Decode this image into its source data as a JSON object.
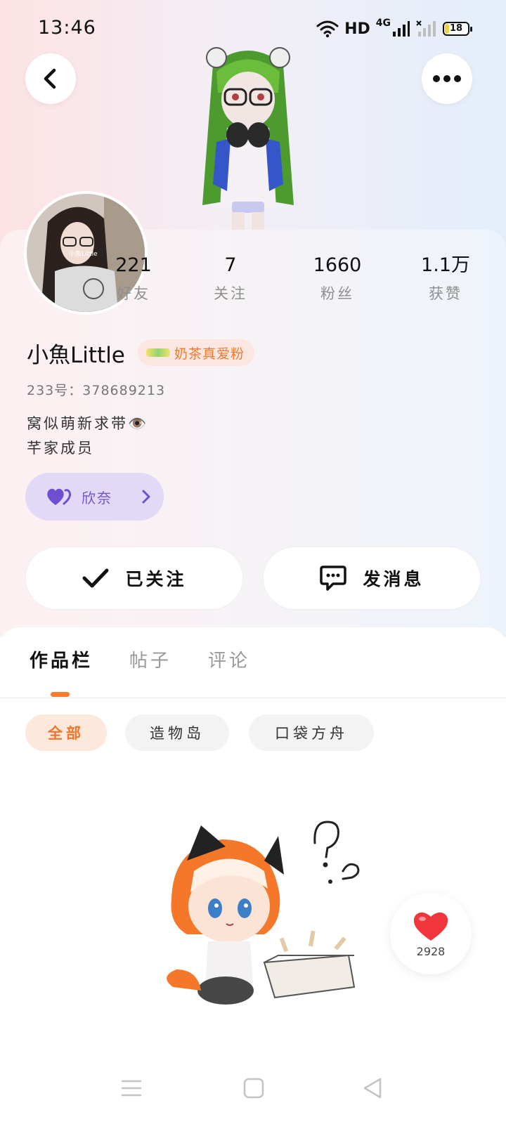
{
  "status_bar": {
    "time": "13:46",
    "hd_label": "HD",
    "network_label": "4G",
    "battery_level": 18,
    "battery_text": "18"
  },
  "header": {
    "back_icon": "chevron-left-icon",
    "more_icon": "more-dots-icon"
  },
  "stats": [
    {
      "value": "221",
      "label": "好友"
    },
    {
      "value": "7",
      "label": "关注"
    },
    {
      "value": "1660",
      "label": "粉丝"
    },
    {
      "value": "1.1万",
      "label": "获赞"
    }
  ],
  "profile": {
    "name": "小魚Little",
    "badge_text": "奶茶真爱粉",
    "uid": "233号：378689213",
    "bio_lines": [
      "窝似萌新求带👁️",
      "芊家成员"
    ],
    "fan_club_label": "欣奈",
    "avatar_caption": "小魚Little"
  },
  "actions": {
    "follow_label": "已关注",
    "message_label": "发消息"
  },
  "tabs": [
    {
      "label": "作品栏",
      "active": true
    },
    {
      "label": "帖子",
      "active": false
    },
    {
      "label": "评论",
      "active": false
    }
  ],
  "filters": [
    {
      "label": "全部",
      "active": true
    },
    {
      "label": "造物岛",
      "active": false
    },
    {
      "label": "口袋方舟",
      "active": false
    }
  ],
  "like_button": {
    "count": "2928",
    "icon": "heart-icon"
  },
  "colors": {
    "accent": "#fb7b2c",
    "fan_purple": "#7154cc",
    "like_red": "#f0353d"
  }
}
